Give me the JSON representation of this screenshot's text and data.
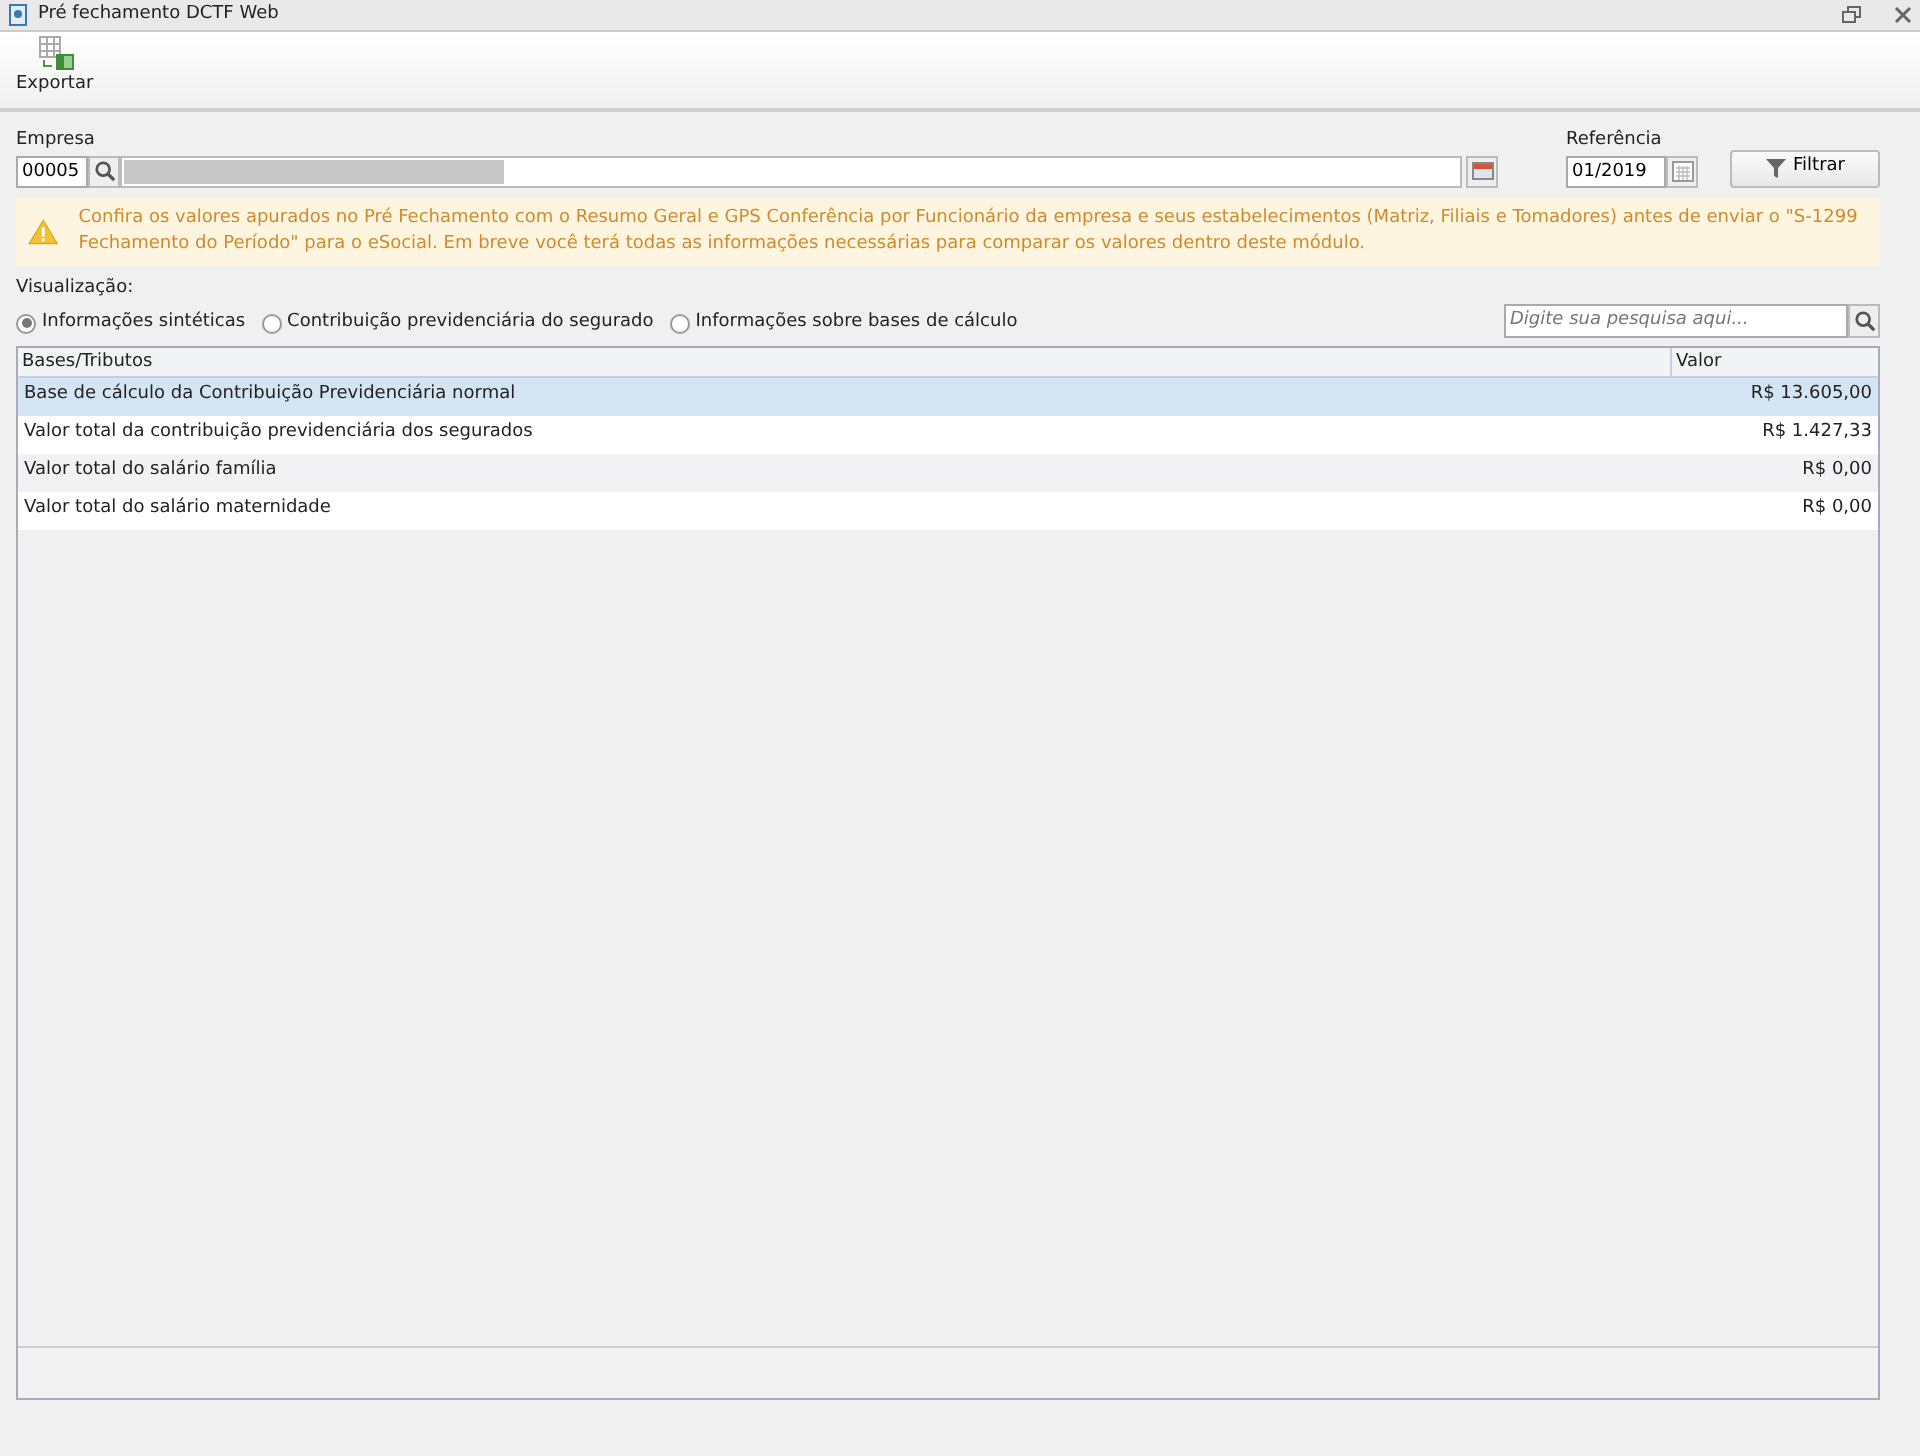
{
  "window": {
    "title": "Pré fechamento DCTF Web"
  },
  "toolbar": {
    "export_label": "Exportar"
  },
  "empresa": {
    "label": "Empresa",
    "code": "00005"
  },
  "referencia": {
    "label": "Referência",
    "value": "01/2019"
  },
  "filter_button": "Filtrar",
  "alert": "Confira os valores apurados no Pré Fechamento com o Resumo Geral e GPS Conferência por Funcionário da empresa e seus estabelecimentos (Matriz, Filiais e Tomadores) antes de enviar o \"S-1299 Fechamento do Período\" para o eSocial. Em breve você terá todas as informações necessárias para comparar os valores dentro deste módulo.",
  "visualizacao": {
    "label": "Visualização:",
    "options": [
      {
        "label": "Informações sintéticas",
        "selected": true
      },
      {
        "label": "Contribuição previdenciária do segurado",
        "selected": false
      },
      {
        "label": "Informações sobre bases de cálculo",
        "selected": false
      }
    ]
  },
  "search": {
    "placeholder": "Digite sua pesquisa aqui..."
  },
  "table": {
    "columns": [
      "Bases/Tributos",
      "Valor"
    ],
    "rows": [
      {
        "cells": [
          "Base de cálculo da Contribuição Previdenciária normal",
          "R$ 13.605,00"
        ],
        "selected": true
      },
      {
        "cells": [
          "Valor total da contribuição previdenciária dos segurados",
          "R$ 1.427,33"
        ],
        "selected": false
      },
      {
        "cells": [
          "Valor total do salário família",
          "R$ 0,00"
        ],
        "selected": false
      },
      {
        "cells": [
          "Valor total do salário maternidade",
          "R$ 0,00"
        ],
        "selected": false
      }
    ]
  }
}
